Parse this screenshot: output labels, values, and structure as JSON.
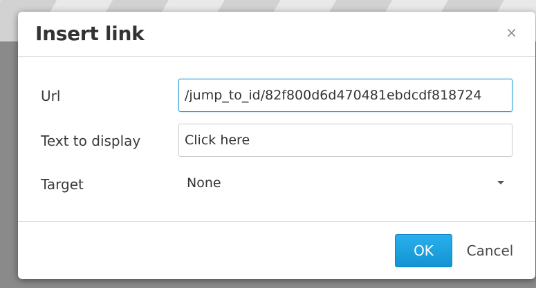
{
  "dialog": {
    "title": "Insert link",
    "close_icon": "×"
  },
  "fields": {
    "url": {
      "label": "Url",
      "value": "/jump_to_id/82f800d6d470481ebdcdf818724"
    },
    "text_to_display": {
      "label": "Text to display",
      "value": "Click here"
    },
    "target": {
      "label": "Target",
      "selected": "None"
    }
  },
  "footer": {
    "ok_label": "OK",
    "cancel_label": "Cancel"
  },
  "colors": {
    "accent": "#1e9fde",
    "focus_border": "#2a9fd6"
  },
  "icons": {
    "close": "close-icon",
    "dropdown": "chevron-down-icon"
  }
}
